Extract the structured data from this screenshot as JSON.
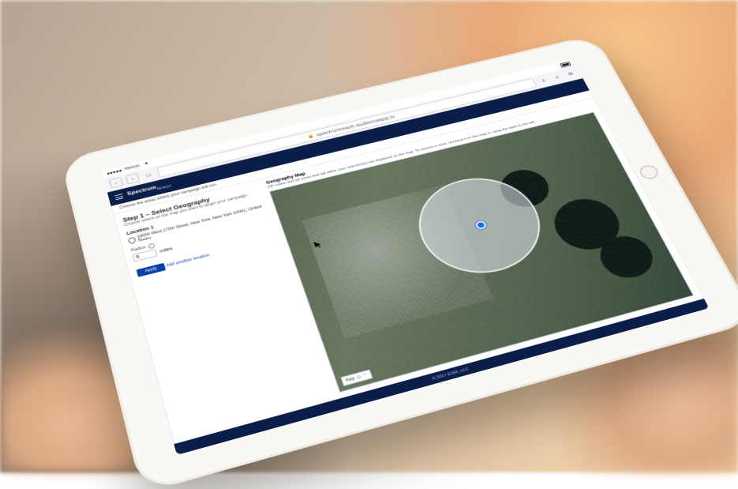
{
  "status": {
    "carrier": "Verizon",
    "time_indicator": "",
    "battery_pct": 80
  },
  "safari": {
    "url": "spectrumreach.audienceapp.tv",
    "back_icon": "chevron-left",
    "fwd_icon": "chevron-right",
    "book_icon": "book",
    "share_icon": "share",
    "add_icon": "plus",
    "tabs_icon": "tabs"
  },
  "app": {
    "brand_main": "Spectrum",
    "brand_sub": "REACH",
    "breadcrumb": "Choose the areas where your campaign will run.",
    "step_title": "Step 1 – Select Geography",
    "step_sub": "Choose where on the map you want to target your campaign.",
    "location_heading": "Location 1",
    "address": "10000 West 170th Street, New York, New York 10001, United States",
    "radius_label": "Radius",
    "radius_value": "5",
    "radius_unit": "miles",
    "apply_label": "Apply",
    "add_location_label": "Add another location",
    "map_title": "Geography Map",
    "map_desc": "ZIP codes and ad zones that fall within your selection(s) are displayed on the map. To remove a zone, uncheck it on the map or using the table to the left.",
    "map_key_label": "Key",
    "footer": "© 2017 ESRI, LLC"
  }
}
